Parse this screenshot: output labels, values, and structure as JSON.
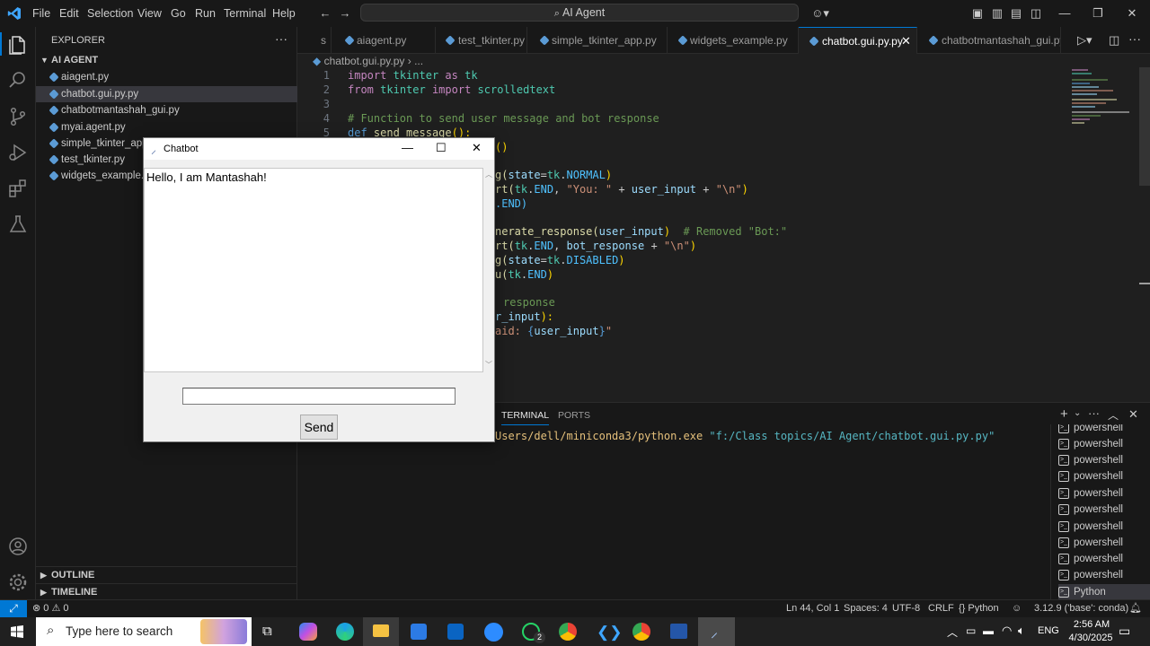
{
  "titlebar": {
    "menus": [
      "File",
      "Edit",
      "Selection",
      "View",
      "Go",
      "Run",
      "Terminal",
      "Help"
    ],
    "command_center": "AI Agent"
  },
  "sidebar": {
    "header": "EXPLORER",
    "folder": "AI AGENT",
    "files": [
      "aiagent.py",
      "chatbot.gui.py.py",
      "chatbotmantashah_gui.py",
      "myai.agent.py",
      "simple_tkinter_app",
      "test_tkinter.py",
      "widgets_example.p"
    ],
    "outline": "OUTLINE",
    "timeline": "TIMELINE"
  },
  "tabs": [
    {
      "label": "s"
    },
    {
      "label": "aiagent.py"
    },
    {
      "label": "test_tkinter.py"
    },
    {
      "label": "simple_tkinter_app.py"
    },
    {
      "label": "widgets_example.py"
    },
    {
      "label": "chatbot.gui.py.py"
    },
    {
      "label": "chatbotmantashah_gui.py"
    }
  ],
  "breadcrumb": {
    "file": "chatbot.gui.py.py",
    "rest": "› ..."
  },
  "editor": {
    "line_numbers": [
      "1",
      "2",
      "3",
      "4",
      "5"
    ],
    "code_fragments": {
      "l1": [
        "import",
        "tkinter",
        "as",
        "tk"
      ],
      "l2": [
        "from",
        "tkinter",
        "import",
        "scrolledtext"
      ],
      "l4": "# Function to send user message and bot response",
      "l5": [
        "def",
        "send_message",
        "():"
      ],
      "l6": "()",
      "l8": [
        "g(",
        "state",
        "=",
        "tk",
        ".",
        "NORMAL",
        ")"
      ],
      "l9": [
        "rt(",
        "tk",
        ".",
        "END",
        ", ",
        "\"You: \"",
        " + ",
        "user_input",
        " + ",
        "\"\\n\"",
        ")"
      ],
      "l10": [
        ".END)"
      ],
      "l12": [
        "nerate_response(",
        "user_input",
        ")",
        "  # Removed \"Bot:\""
      ],
      "l13": [
        "rt(",
        "tk",
        ".",
        "END",
        ", ",
        "bot_response",
        " + ",
        "\"\\n\"",
        ")"
      ],
      "l14": [
        "g(",
        "state",
        "=",
        "tk",
        ".",
        "DISABLED",
        ")"
      ],
      "l15": [
        "u(",
        "tk",
        ".",
        "END",
        ")"
      ],
      "l17": "response",
      "l18": [
        "r_input",
        "):"
      ],
      "l19": [
        "aid: ",
        "{",
        "user_input",
        "}",
        "\""
      ]
    }
  },
  "panel": {
    "tabs": [
      "TERMINAL",
      "PORTS"
    ],
    "active_tab": "TERMINAL",
    "command_prefix": "Users/dell/miniconda3/python.exe",
    "command_arg": "\"f:/Class topics/AI Agent/chatbot.gui.py.py\"",
    "terminals": [
      "powershell",
      "powershell",
      "powershell",
      "powershell",
      "powershell",
      "powershell",
      "powershell",
      "powershell",
      "powershell",
      "powershell",
      "Python"
    ]
  },
  "statusbar": {
    "errors": "0",
    "warnings": "0",
    "position": "Ln 44, Col 1",
    "spaces": "Spaces: 4",
    "encoding": "UTF-8",
    "eol": "CRLF",
    "language": "Python",
    "interpreter": "3.12.9 ('base': conda)"
  },
  "tkwindow": {
    "title": "Chatbot",
    "chat_text": "Hello, I am Mantashah!",
    "entry_value": "",
    "send_label": "Send"
  },
  "taskbar": {
    "search_placeholder": "Type here to search",
    "language": "ENG",
    "time": "2:56 AM",
    "date": "4/30/2025",
    "whatsapp_badge": "2"
  },
  "colors": {
    "accent": "#0078d4",
    "editor_bg": "#1f1f1f",
    "chrome_bg": "#181818"
  }
}
